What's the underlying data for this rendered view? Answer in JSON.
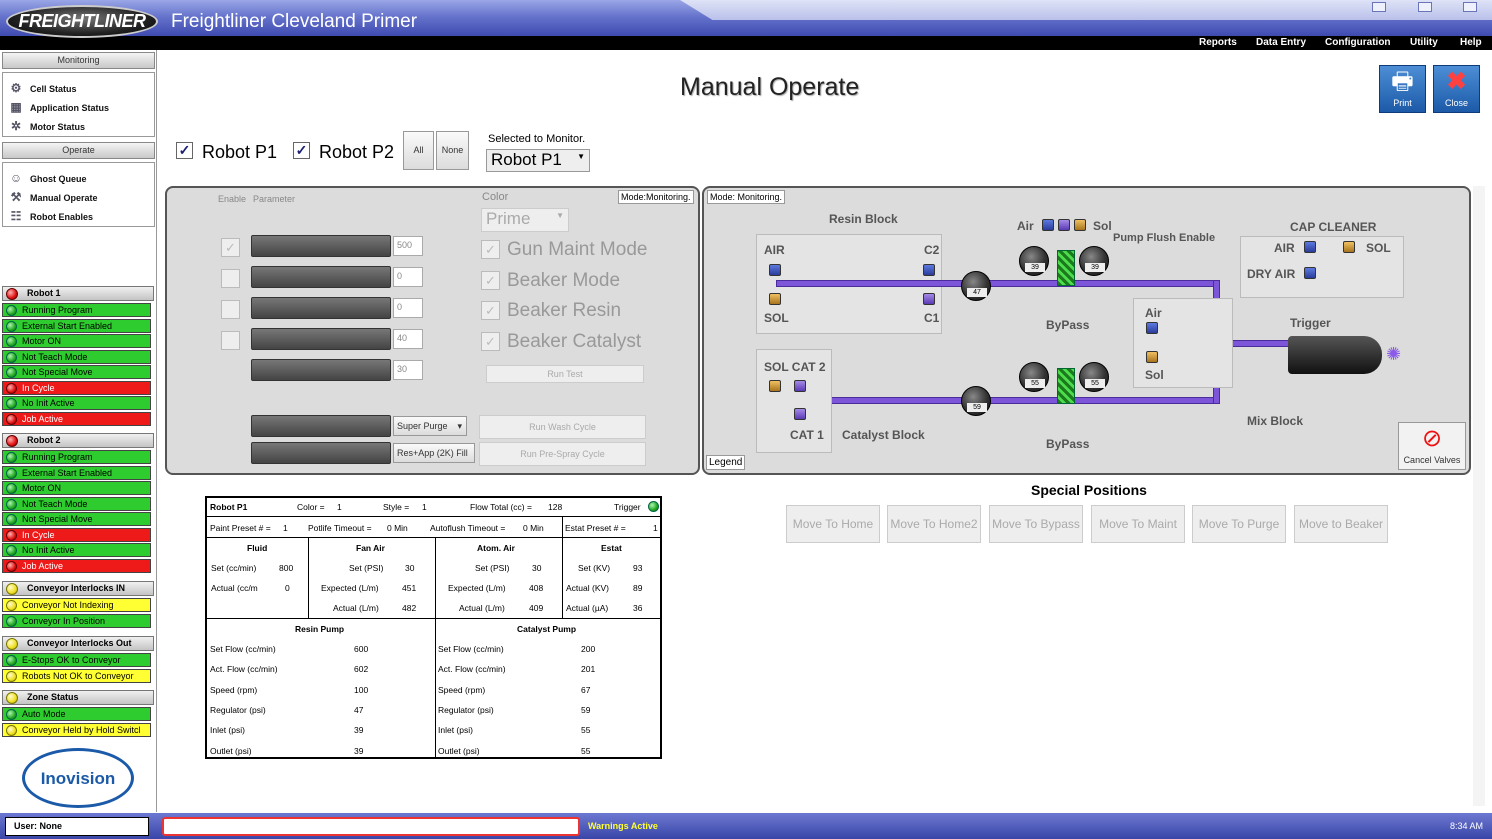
{
  "app": {
    "logo": "FREIGHTLINER",
    "title": "Freightliner Cleveland Primer"
  },
  "menu": [
    "Reports",
    "Data Entry",
    "Configuration",
    "Utility",
    "Help"
  ],
  "sidebar": {
    "monitoring_header": "Monitoring",
    "monitoring_items": [
      {
        "label": "Cell Status",
        "icon": "cell-status-icon"
      },
      {
        "label": "Application Status",
        "icon": "application-status-icon"
      },
      {
        "label": "Motor Status",
        "icon": "motor-status-icon"
      }
    ],
    "operate_header": "Operate",
    "operate_items": [
      {
        "label": "Ghost Queue",
        "icon": "ghost-queue-icon"
      },
      {
        "label": "Manual Operate",
        "icon": "manual-operate-icon"
      },
      {
        "label": "Robot Enables",
        "icon": "robot-enables-icon"
      }
    ],
    "groups": [
      {
        "title": "Robot 1",
        "led": "red",
        "items": [
          {
            "t": "Running Program",
            "c": "green"
          },
          {
            "t": "External Start Enabled",
            "c": "green"
          },
          {
            "t": "Motor ON",
            "c": "green"
          },
          {
            "t": "Not Teach Mode",
            "c": "green"
          },
          {
            "t": "Not Special Move",
            "c": "green"
          },
          {
            "t": "In Cycle",
            "c": "red"
          },
          {
            "t": "No Init Active",
            "c": "green"
          },
          {
            "t": "Job Active",
            "c": "red"
          }
        ]
      },
      {
        "title": "Robot 2",
        "led": "red",
        "items": [
          {
            "t": "Running Program",
            "c": "green"
          },
          {
            "t": "External Start Enabled",
            "c": "green"
          },
          {
            "t": "Motor ON",
            "c": "green"
          },
          {
            "t": "Not Teach Mode",
            "c": "green"
          },
          {
            "t": "Not Special Move",
            "c": "green"
          },
          {
            "t": "In Cycle",
            "c": "red"
          },
          {
            "t": "No Init Active",
            "c": "green"
          },
          {
            "t": "Job Active",
            "c": "red"
          }
        ]
      },
      {
        "title": "Conveyor Interlocks IN",
        "led": "yellow",
        "items": [
          {
            "t": "Conveyor Not Indexing",
            "c": "yellow"
          },
          {
            "t": "Conveyor In Position",
            "c": "green"
          }
        ]
      },
      {
        "title": "Conveyor Interlocks Out",
        "led": "yellow",
        "items": [
          {
            "t": "E-Stops OK to Conveyor",
            "c": "green"
          },
          {
            "t": "Robots Not OK to Conveyor",
            "c": "yellow"
          }
        ]
      },
      {
        "title": "Zone Status",
        "led": "yellow",
        "items": [
          {
            "t": "Auto Mode",
            "c": "green"
          },
          {
            "t": "Conveyor Held by Hold Switcl",
            "c": "yellow"
          }
        ]
      }
    ],
    "brand": "Inovision"
  },
  "page": {
    "title": "Manual Operate",
    "print_label": "Print",
    "close_label": "Close"
  },
  "robots": {
    "p1": "Robot P1",
    "p2": "Robot P2",
    "all": "All",
    "none": "None",
    "selected_label": "Selected to Monitor.",
    "selected_value": "Robot P1"
  },
  "params": {
    "enable_hdr": "Enable",
    "param_hdr": "Parameter",
    "mode": "Mode:Monitoring.",
    "values": [
      "500",
      "0",
      "0",
      "40",
      "30"
    ],
    "color_label": "Color",
    "color_value": "Prime",
    "modes": [
      "Gun Maint Mode",
      "Beaker Mode",
      "Beaker Resin",
      "Beaker Catalyst"
    ],
    "run_test": "Run Test",
    "purge_select": "Super Purge",
    "prespray_select": "Res+App (2K) Fill",
    "run_wash": "Run Wash Cycle",
    "run_prespray": "Run Pre-Spray Cycle"
  },
  "diagram": {
    "mode": "Mode: Monitoring.",
    "resin_block": "Resin Block",
    "air": "AIR",
    "c2": "C2",
    "sol": "SOL",
    "c1": "C1",
    "air2": "Air",
    "sol2": "Sol",
    "pump_flush": "Pump Flush Enable",
    "cap_cleaner": "CAP CLEANER",
    "cap_air": "AIR",
    "cap_sol": "SOL",
    "dry_air": "DRY AIR",
    "bypass": "ByPass",
    "mix_air": "Air",
    "mix_sol": "Sol",
    "trigger": "Trigger",
    "sol_cat2": "SOL CAT 2",
    "cat1": "CAT 1",
    "catalyst_block": "Catalyst Block",
    "bypass2": "ByPass",
    "mix_block": "Mix Block",
    "legend": "Legend",
    "cancel_valves": "Cancel Valves",
    "gauges": {
      "resin_reg": "47",
      "resin_in": "39",
      "resin_out": "39",
      "cat_reg": "59",
      "cat_in": "55",
      "cat_out": "55"
    }
  },
  "special": {
    "title": "Special Positions",
    "buttons": [
      "Move To Home",
      "Move To Home2",
      "Move To Bypass",
      "Move To Maint",
      "Move To Purge",
      "Move to Beaker"
    ]
  },
  "info": {
    "robot": "Robot P1",
    "color": "Color =",
    "color_v": "1",
    "style": "Style =",
    "style_v": "1",
    "flow": "Flow Total (cc) =",
    "flow_v": "128",
    "trigger": "Trigger",
    "paint_preset": "Paint Preset # =",
    "paint_preset_v": "1",
    "potlife": "Potlife Timeout =",
    "potlife_v": "0 Min",
    "autoflush": "Autoflush Timeout =",
    "autoflush_v": "0 Min",
    "estat_preset": "Estat Preset # =",
    "estat_preset_v": "1",
    "fluid": {
      "title": "Fluid",
      "set": "Set (cc/min)",
      "set_v": "800",
      "actual": "Actual (cc/m",
      "actual_v": "0"
    },
    "fan": {
      "title": "Fan Air",
      "set": "Set (PSI)",
      "set_v": "30",
      "expected": "Expected (L/m)",
      "expected_v": "451",
      "actual": "Actual (L/m)",
      "actual_v": "482"
    },
    "atom": {
      "title": "Atom. Air",
      "set": "Set (PSI)",
      "set_v": "30",
      "expected": "Expected (L/m)",
      "expected_v": "408",
      "actual": "Actual (L/m)",
      "actual_v": "409"
    },
    "estat": {
      "title": "Estat",
      "set": "Set (KV)",
      "set_v": "93",
      "actual_kv": "Actual (KV)",
      "actual_kv_v": "89",
      "actual_ua": "Actual (µA)",
      "actual_ua_v": "36"
    },
    "resin": {
      "title": "Resin Pump",
      "rows": [
        [
          "Set Flow (cc/min)",
          "600"
        ],
        [
          "Act. Flow (cc/min)",
          "602"
        ],
        [
          "Speed (rpm)",
          "100"
        ],
        [
          "Regulator (psi)",
          "47"
        ],
        [
          "Inlet (psi)",
          "39"
        ],
        [
          "Outlet (psi)",
          "39"
        ]
      ]
    },
    "catalyst": {
      "title": "Catalyst Pump",
      "rows": [
        [
          "Set Flow (cc/min)",
          "200"
        ],
        [
          "Act. Flow (cc/min)",
          "201"
        ],
        [
          "Speed (rpm)",
          "67"
        ],
        [
          "Regulator (psi)",
          "59"
        ],
        [
          "Inlet (psi)",
          "55"
        ],
        [
          "Outlet (psi)",
          "55"
        ]
      ]
    }
  },
  "status": {
    "user": "User:  None",
    "warnings": "Warnings Active",
    "time": "8:34 AM"
  },
  "colors": {
    "green": "#2ecc2e",
    "red": "#ee1a1a",
    "yellow": "#ffff33",
    "pipe": "#7d55d8"
  }
}
